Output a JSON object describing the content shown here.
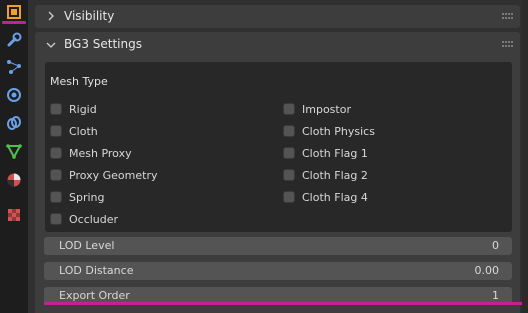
{
  "sidebar": {
    "icons": [
      "object-properties-icon",
      "wrench-icon",
      "particles-icon",
      "physics-icon",
      "constraints-icon",
      "object-data-icon",
      "material-icon",
      "texture-icon"
    ]
  },
  "panels": {
    "visibility": {
      "title": "Visibility"
    },
    "bg3": {
      "title": "BG3 Settings"
    }
  },
  "mesh_type": {
    "title": "Mesh Type",
    "left": [
      "Rigid",
      "Cloth",
      "Mesh Proxy",
      "Proxy Geometry",
      "Spring",
      "Occluder"
    ],
    "right": [
      "Impostor",
      "Cloth Physics",
      "Cloth Flag 1",
      "Cloth Flag 2",
      "Cloth Flag 4"
    ]
  },
  "fields": {
    "lod_level": {
      "label": "LOD Level",
      "value": "0"
    },
    "lod_distance": {
      "label": "LOD Distance",
      "value": "0.00"
    },
    "export_order": {
      "label": "Export Order",
      "value": "1"
    }
  },
  "colors": {
    "highlight": "#c51f9a",
    "panel": "#3d3d3d",
    "subpanel": "#282828",
    "field": "#545454"
  }
}
